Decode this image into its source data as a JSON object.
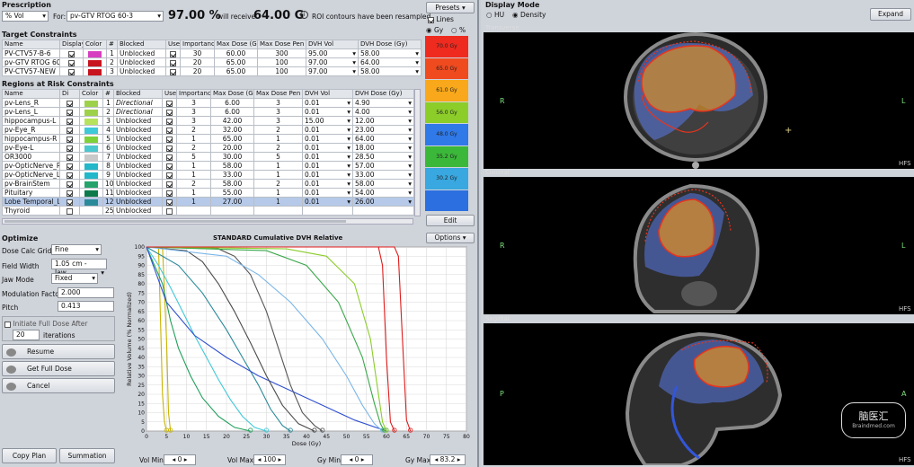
{
  "prescription": {
    "title": "Prescription",
    "mode": "% Vol",
    "for_label": "For:",
    "target": "pv-GTV RTOG 60-3",
    "percent": "97.00 %",
    "will_receive": "will receive",
    "dose": "64.00 G",
    "roi_note": "ROI contours have been resampled",
    "presets_label": "Presets",
    "lines_label": "Lines",
    "gy_label": "Gy",
    "pct_label": "%"
  },
  "target_constraints": {
    "title": "Target Constraints",
    "headers": [
      "Name",
      "Display",
      "Color",
      "#",
      "Blocked",
      "Use",
      "Importance",
      "Max Dose (Gy)",
      "Max Dose Pen",
      "DVH Vol",
      "DVH Dose (Gy)"
    ],
    "rows": [
      {
        "name": "PV-CTV57-B-6",
        "color": "#d63fbf",
        "num": "1",
        "blocked": "Unblocked",
        "importance": "30",
        "max_dose": "60.00",
        "max_pen": "300",
        "dvh_vol": "95.00",
        "dvh_dose": "58.00",
        "bold": false
      },
      {
        "name": "pv-GTV RTOG 60-",
        "color": "#c8141e",
        "num": "2",
        "blocked": "Unblocked",
        "importance": "20",
        "max_dose": "65.00",
        "max_pen": "100",
        "dvh_vol": "97.00",
        "dvh_dose": "64.00",
        "bold": true
      },
      {
        "name": "PV-CTV57-NEW",
        "color": "#c8141e",
        "num": "3",
        "blocked": "Unblocked",
        "importance": "20",
        "max_dose": "65.00",
        "max_pen": "100",
        "dvh_vol": "97.00",
        "dvh_dose": "58.00",
        "bold": false
      }
    ]
  },
  "oar_constraints": {
    "title": "Regions at Risk Constraints",
    "headers": [
      "Name",
      "Di",
      "Color",
      "#",
      "Blocked",
      "Use",
      "Importance",
      "Max Dose (Gy)",
      "Max Dose Pen",
      "DVH Vol",
      "DVH Dose (Gy)"
    ],
    "rows": [
      {
        "name": "pv-Lens_R",
        "color": "#9ed14a",
        "num": "1",
        "blocked": "Directional",
        "importance": "3",
        "max_dose": "6.00",
        "max_pen": "3",
        "dvh_vol": "0.01",
        "dvh_dose": "4.90",
        "italic": true
      },
      {
        "name": "pv-Lens_L",
        "color": "#9ed14a",
        "num": "2",
        "blocked": "Directional",
        "importance": "3",
        "max_dose": "6.00",
        "max_pen": "3",
        "dvh_vol": "0.01",
        "dvh_dose": "4.00",
        "italic": true
      },
      {
        "name": "hippocampus-L",
        "color": "#b7e35c",
        "num": "3",
        "blocked": "Unblocked",
        "importance": "3",
        "max_dose": "42.00",
        "max_pen": "3",
        "dvh_vol": "15.00",
        "dvh_dose": "12.00"
      },
      {
        "name": "pv-Eye_R",
        "color": "#3ec9d8",
        "num": "4",
        "blocked": "Unblocked",
        "importance": "2",
        "max_dose": "32.00",
        "max_pen": "2",
        "dvh_vol": "0.01",
        "dvh_dose": "23.00"
      },
      {
        "name": "hippocampus-R",
        "color": "#7fd13a",
        "num": "5",
        "blocked": "Unblocked",
        "importance": "1",
        "max_dose": "65.00",
        "max_pen": "1",
        "dvh_vol": "0.01",
        "dvh_dose": "64.00"
      },
      {
        "name": "pv-Eye-L",
        "color": "#4bc7cf",
        "num": "6",
        "blocked": "Unblocked",
        "importance": "2",
        "max_dose": "20.00",
        "max_pen": "2",
        "dvh_vol": "0.01",
        "dvh_dose": "18.00"
      },
      {
        "name": "OR3000",
        "color": "#c9c9c9",
        "num": "7",
        "blocked": "Unblocked",
        "importance": "5",
        "max_dose": "30.00",
        "max_pen": "5",
        "dvh_vol": "0.01",
        "dvh_dose": "28.50"
      },
      {
        "name": "pv-OpticNerve_R",
        "color": "#22b7c9",
        "num": "8",
        "blocked": "Unblocked",
        "importance": "1",
        "max_dose": "58.00",
        "max_pen": "1",
        "dvh_vol": "0.01",
        "dvh_dose": "57.00"
      },
      {
        "name": "pv-OpticNerve_L",
        "color": "#22b7c9",
        "num": "9",
        "blocked": "Unblocked",
        "importance": "1",
        "max_dose": "33.00",
        "max_pen": "1",
        "dvh_vol": "0.01",
        "dvh_dose": "33.00"
      },
      {
        "name": "pv-BrainStem",
        "color": "#25a36b",
        "num": "10",
        "blocked": "Unblocked",
        "importance": "2",
        "max_dose": "58.00",
        "max_pen": "2",
        "dvh_vol": "0.01",
        "dvh_dose": "58.00"
      },
      {
        "name": "Pituitary",
        "color": "#0c7a4b",
        "num": "11",
        "blocked": "Unblocked",
        "importance": "1",
        "max_dose": "55.00",
        "max_pen": "1",
        "dvh_vol": "0.01",
        "dvh_dose": "54.00"
      },
      {
        "name": "Lobe Temporal_L",
        "color": "#2a8a9a",
        "num": "12",
        "blocked": "Unblocked",
        "importance": "1",
        "max_dose": "27.00",
        "max_pen": "1",
        "dvh_vol": "0.01",
        "dvh_dose": "26.00",
        "selected": true
      },
      {
        "name": "Thyroid",
        "color": "#ffffff",
        "num": "25",
        "blocked": "Unblocked",
        "importance": "",
        "max_dose": "",
        "max_pen": "",
        "dvh_vol": "",
        "dvh_dose": ""
      }
    ]
  },
  "colorwash": {
    "items": [
      {
        "label": "70.0 Gy",
        "color": "#ef2a1f"
      },
      {
        "label": "65.0 Gy",
        "color": "#f04a1f"
      },
      {
        "label": "61.0 Gy",
        "color": "#f8a81a"
      },
      {
        "label": "56.0 Gy",
        "color": "#8ccd2a"
      },
      {
        "label": "48.0 Gy",
        "color": "#2f79e8"
      },
      {
        "label": "35.2 Gy",
        "color": "#3bb83a"
      },
      {
        "label": "30.2 Gy",
        "color": "#39a7e0"
      },
      {
        "label": "",
        "color": "#2b6fe0"
      }
    ],
    "edit_label": "Edit"
  },
  "optimize": {
    "title": "Optimize",
    "dose_calc_grid_label": "Dose Calc Grid",
    "dose_calc_grid": "Fine",
    "field_width_label": "Field Width",
    "field_width": "1.05 cm - Jaw...",
    "jaw_mode_label": "Jaw Mode",
    "jaw_mode": "Fixed",
    "modulation_label": "Modulation Factor",
    "modulation": "2.000",
    "pitch_label": "Pitch",
    "pitch": "0.413",
    "initiate_label": "Initiate Full Dose After",
    "iterations_value": "20",
    "iterations_label": "iterations",
    "resume_label": "Resume",
    "full_dose_label": "Get Full Dose",
    "cancel_label": "Cancel"
  },
  "bottom_buttons": {
    "copy_plan": "Copy Plan",
    "summation": "Summation"
  },
  "chart_options_label": "Options",
  "chart_data": {
    "type": "line",
    "title": "STANDARD Cumulative DVH Relative",
    "xlabel": "Dose (Gy)",
    "ylabel": "Relative Volume (% Normalized)",
    "xlim": [
      0,
      80
    ],
    "ylim": [
      0,
      100
    ],
    "xticks": [
      0,
      5,
      10,
      15,
      20,
      25,
      30,
      35,
      40,
      45,
      50,
      55,
      60,
      65,
      70,
      75,
      80
    ],
    "yticks": [
      0,
      5,
      10,
      15,
      20,
      25,
      30,
      35,
      40,
      45,
      50,
      55,
      60,
      65,
      70,
      75,
      80,
      85,
      90,
      95,
      100
    ],
    "grid": true,
    "series": [
      {
        "color": "#c9b400",
        "x": [
          0,
          3,
          3.5,
          4,
          4.5,
          5
        ],
        "y": [
          100,
          100,
          60,
          20,
          5,
          0
        ]
      },
      {
        "color": "#c9b400",
        "x": [
          0,
          4,
          5,
          5.5,
          6
        ],
        "y": [
          100,
          100,
          50,
          10,
          0
        ]
      },
      {
        "color": "#1f9f5a",
        "x": [
          0,
          4,
          6,
          8,
          11,
          14,
          18,
          22,
          26
        ],
        "y": [
          100,
          80,
          60,
          45,
          30,
          18,
          8,
          2,
          0
        ]
      },
      {
        "color": "#3ec9d8",
        "x": [
          0,
          3,
          6,
          9,
          12,
          15,
          18,
          21,
          24,
          27,
          30
        ],
        "y": [
          100,
          90,
          78,
          65,
          52,
          40,
          28,
          17,
          8,
          2,
          0
        ]
      },
      {
        "color": "#2a8a9a",
        "x": [
          0,
          8,
          14,
          20,
          24,
          28,
          31,
          34,
          36
        ],
        "y": [
          100,
          90,
          75,
          55,
          40,
          25,
          12,
          3,
          0
        ]
      },
      {
        "color": "#2f4fd0",
        "x": [
          0,
          5,
          12,
          20,
          28,
          36,
          44,
          52,
          60
        ],
        "y": [
          100,
          70,
          52,
          40,
          30,
          22,
          14,
          6,
          0
        ]
      },
      {
        "color": "#4a4a4a",
        "x": [
          0,
          10,
          14,
          18,
          22,
          26,
          30,
          34,
          38,
          42
        ],
        "y": [
          100,
          98,
          92,
          80,
          65,
          48,
          30,
          14,
          4,
          0
        ]
      },
      {
        "color": "#555555",
        "x": [
          0,
          18,
          22,
          26,
          30,
          33,
          36,
          39,
          42,
          44
        ],
        "y": [
          100,
          99,
          95,
          85,
          65,
          45,
          25,
          10,
          3,
          0
        ]
      },
      {
        "color": "#7bb6e8",
        "x": [
          0,
          20,
          28,
          36,
          44,
          50,
          54,
          57,
          59
        ],
        "y": [
          100,
          95,
          85,
          70,
          50,
          30,
          14,
          4,
          0
        ]
      },
      {
        "color": "#3aa84a",
        "x": [
          0,
          30,
          40,
          48,
          54,
          57,
          58.5,
          59.5
        ],
        "y": [
          100,
          98,
          90,
          70,
          40,
          15,
          4,
          0
        ]
      },
      {
        "color": "#8ccd2a",
        "x": [
          0,
          35,
          45,
          52,
          56,
          58,
          59,
          60
        ],
        "y": [
          100,
          99,
          95,
          80,
          50,
          20,
          5,
          0
        ]
      },
      {
        "color": "#e01a1a",
        "x": [
          0,
          58,
          59,
          60,
          61,
          62
        ],
        "y": [
          100,
          100,
          90,
          40,
          5,
          0
        ]
      },
      {
        "color": "#e01a1a",
        "x": [
          0,
          62,
          63,
          64,
          65,
          66
        ],
        "y": [
          100,
          100,
          95,
          50,
          6,
          0
        ]
      }
    ]
  },
  "scrollers": {
    "vol_min_label": "Vol Min",
    "vol_min": "0",
    "vol_max_label": "Vol Max",
    "vol_max": "100",
    "gy_min_label": "Gy Min",
    "gy_min": "0",
    "gy_max_label": "Gy Max",
    "gy_max": "83.2"
  },
  "display_mode": {
    "title": "Display Mode",
    "hu_label": "HU",
    "density_label": "Density",
    "expand_label": "Expand"
  },
  "views": {
    "transverse": {
      "label": "Transverse",
      "left": "R",
      "right": "L",
      "corner": "HFS"
    },
    "coronal": {
      "label": "Coronal",
      "left": "R",
      "right": "L",
      "corner": "HFS"
    },
    "sagittal": {
      "label": "Sagittal",
      "left": "P",
      "right": "A",
      "corner": "HFS"
    }
  },
  "watermark": {
    "text": "脑医汇",
    "sub": "Braindmed.com"
  }
}
